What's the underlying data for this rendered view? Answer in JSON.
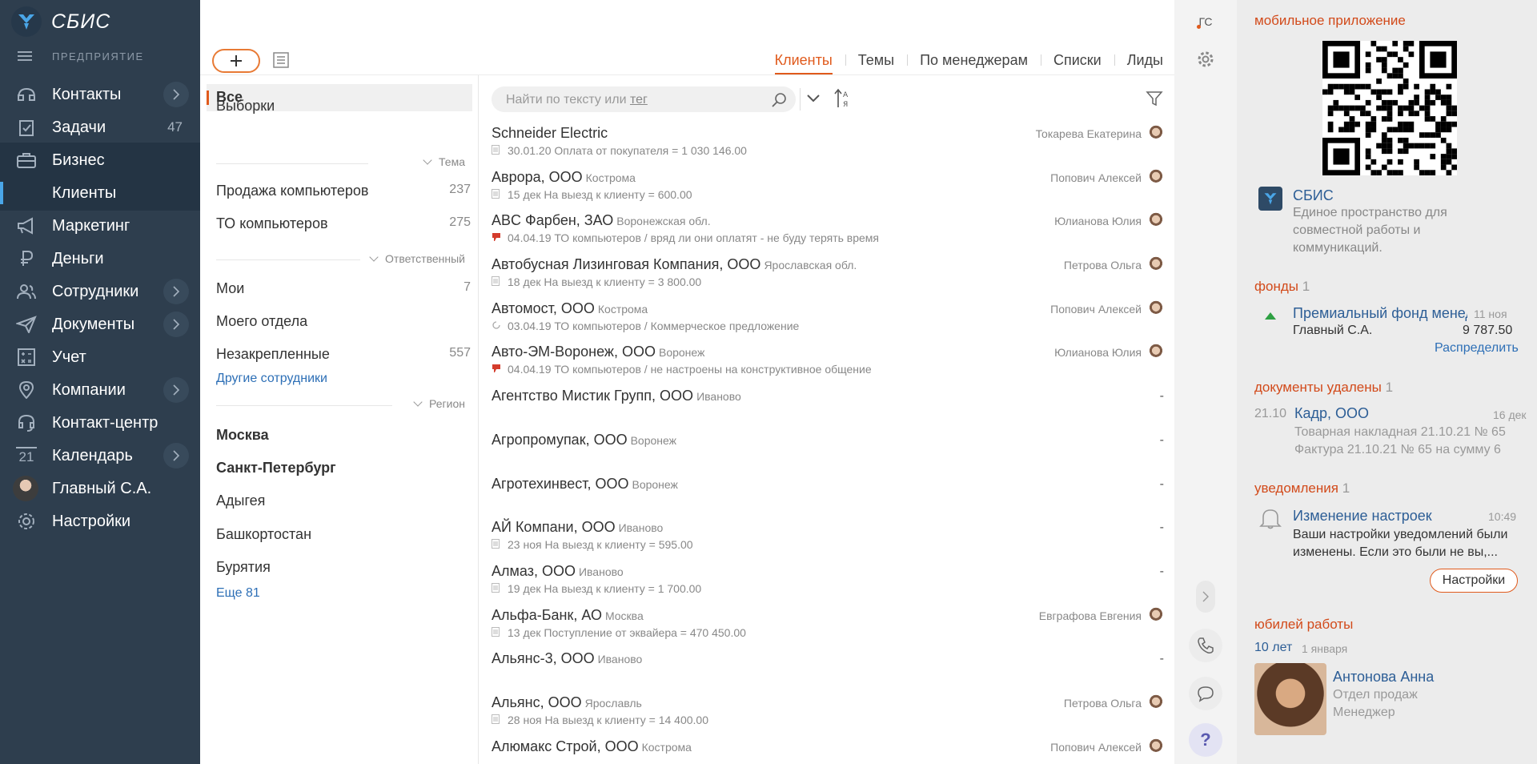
{
  "nav": {
    "brand": "СБИС",
    "org": "ПРЕДПРИЯТИЕ",
    "items": [
      {
        "label": "Контакты",
        "count": ""
      },
      {
        "label": "Задачи",
        "count": "47"
      },
      {
        "label": "Бизнес",
        "count": ""
      },
      {
        "label": "Клиенты",
        "count": ""
      },
      {
        "label": "Маркетинг",
        "count": ""
      },
      {
        "label": "Деньги",
        "count": ""
      },
      {
        "label": "Сотрудники",
        "count": ""
      },
      {
        "label": "Документы",
        "count": ""
      },
      {
        "label": "Учет",
        "count": ""
      },
      {
        "label": "Компании",
        "count": ""
      },
      {
        "label": "Контакт-центр",
        "count": ""
      },
      {
        "label": "Календарь",
        "count": ""
      },
      {
        "label": "Главный С.А.",
        "count": ""
      },
      {
        "label": "Настройки",
        "count": ""
      }
    ],
    "calendar_day": "21"
  },
  "tabs": [
    "Клиенты",
    "Темы",
    "По менеджерам",
    "Списки",
    "Лиды"
  ],
  "filters": {
    "all": "Все",
    "selections": "Выборки",
    "group_topic": "Тема",
    "topics": [
      {
        "label": "Продажа компьютеров",
        "count": "237"
      },
      {
        "label": "ТО компьютеров",
        "count": "275"
      }
    ],
    "group_responsible": "Ответственный",
    "responsible": [
      {
        "label": "Мои",
        "count": "7"
      },
      {
        "label": "Моего отдела",
        "count": ""
      },
      {
        "label": "Незакрепленные",
        "count": "557"
      }
    ],
    "other_employees": "Другие сотрудники",
    "group_region": "Регион",
    "regions": [
      "Москва",
      "Санкт-Петербург",
      "Адыгея",
      "Башкортостан",
      "Бурятия"
    ],
    "more": "Еще 81"
  },
  "search": {
    "placeholder": "Найти по тексту или",
    "tag": "тег"
  },
  "clients": [
    {
      "name": "Schneider Electric",
      "city": "",
      "sub": "30.01.20  Оплата от покупателя  = 1 030 146.00",
      "manager": "Токарева Екатерина"
    },
    {
      "name": "Аврора, ООО",
      "city": "Кострома",
      "sub": "15 дек  На выезд к клиенту  = 600.00",
      "manager": "Попович Алексей"
    },
    {
      "name": "ABC Фарбен, ЗАО",
      "city": "Воронежская обл.",
      "sub": "04.04.19  ТО компьютеров / вряд ли они оплатят - не буду терять время",
      "manager": "Юлианова Юлия"
    },
    {
      "name": "Автобусная Лизинговая Компания, ООО",
      "city": "Ярославская обл.",
      "sub": "18 дек  На выезд к клиенту  = 3 800.00",
      "manager": "Петрова Ольга"
    },
    {
      "name": "Автомост, ООО",
      "city": "Кострома",
      "sub": "03.04.19  ТО компьютеров / Коммерческое предложение",
      "manager": "Попович Алексей"
    },
    {
      "name": "Авто-ЭМ-Воронеж, ООО",
      "city": "Воронеж",
      "sub": "04.04.19  ТО компьютеров / не настроены на конструктивное общение",
      "manager": "Юлианова Юлия"
    },
    {
      "name": "Агентство Мистик Групп, ООО",
      "city": "Иваново",
      "sub": "",
      "manager": "-"
    },
    {
      "name": "Агропромупак, ООО",
      "city": "Воронеж",
      "sub": "",
      "manager": "-"
    },
    {
      "name": "Агротехинвест, ООО",
      "city": "Воронеж",
      "sub": "",
      "manager": "-"
    },
    {
      "name": "АЙ Компани, ООО",
      "city": "Иваново",
      "sub": "23 ноя  На выезд к клиенту  = 595.00",
      "manager": "-"
    },
    {
      "name": "Алмаз, ООО",
      "city": "Иваново",
      "sub": "19 дек  На выезд к клиенту  = 1 700.00",
      "manager": "-"
    },
    {
      "name": "Альфа-Банк, АО",
      "city": "Москва",
      "sub": "13 дек  Поступление от эквайера  = 470 450.00",
      "manager": "Евграфова Евгения"
    },
    {
      "name": "Альянс-3, ООО",
      "city": "Иваново",
      "sub": "",
      "manager": "-"
    },
    {
      "name": "Альянс, ООО",
      "city": "Ярославль",
      "sub": "28 ноя  На выезд к клиенту  = 14 400.00",
      "manager": "Петрова Ольга"
    },
    {
      "name": "Алюмакс Строй, ООО",
      "city": "Кострома",
      "sub": "",
      "manager": "Попович Алексей"
    }
  ],
  "strip": {
    "user_initials": "ГС"
  },
  "info": {
    "mobile_title": "мобильное приложение",
    "app_name": "СБИС",
    "app_desc": [
      "Единое пространство для",
      "совместной работы и",
      "коммуникаций."
    ],
    "funds_title": "фонды",
    "funds_count": "1",
    "fund_name": "Премиальный фонд менеджеров",
    "fund_date": "11 ноя",
    "fund_owner": "Главный С.А.",
    "fund_amount": "9 787.50",
    "fund_action": "Распределить",
    "docs_title": "документы удалены",
    "docs_count": "1",
    "doc_day": "21.10",
    "doc_org": "Кадр, ООО",
    "doc_date": "16 дек",
    "doc_line1": "Товарная накладная 21.10.21 № 65",
    "doc_line2": "Фактура 21.10.21 № 65 на сумму 6",
    "notif_title": "уведомления",
    "notif_count": "1",
    "notif_name": "Изменение настроек",
    "notif_time": "10:49",
    "notif_text1": "Ваши настройки уведомлений были",
    "notif_text2": "изменены. Если это были не вы,...",
    "notif_button": "Настройки",
    "jubilee_title": "юбилей работы",
    "jubilee_years": "10 лет",
    "jubilee_date": "1 января",
    "emp_name": "Антонова Анна",
    "emp_dept": "Отдел продаж",
    "emp_role": "Менеджер"
  }
}
